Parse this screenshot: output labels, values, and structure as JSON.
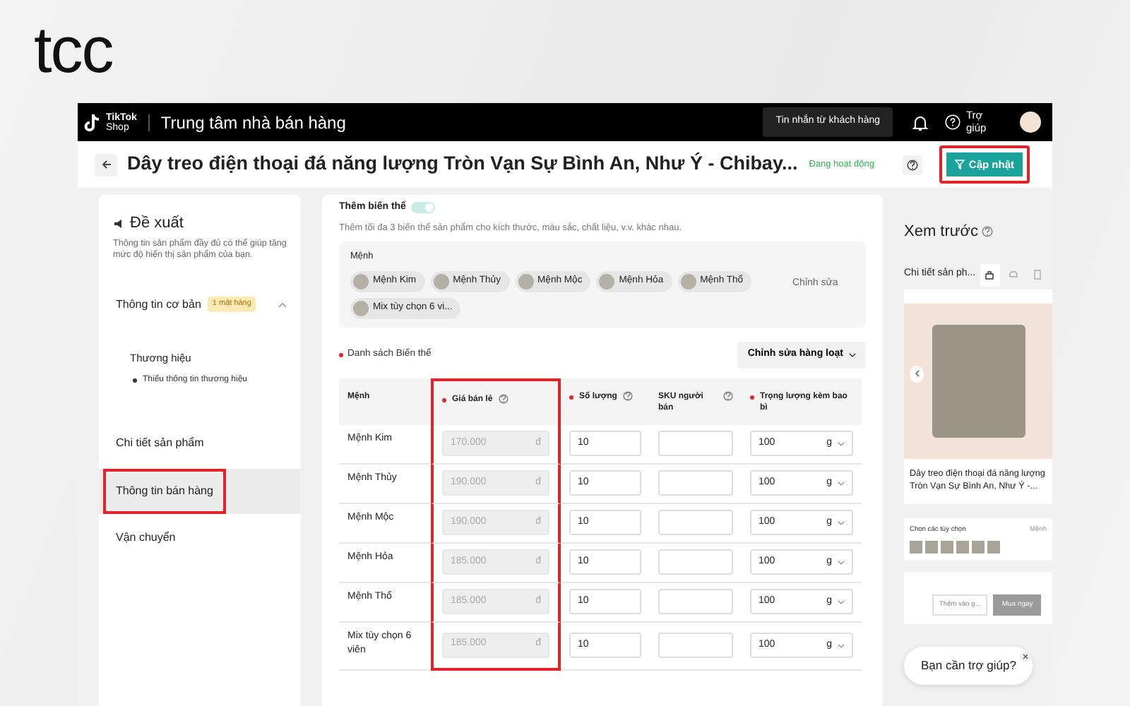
{
  "brand_logo": {
    "text": "tcc"
  },
  "header": {
    "shop_logo": {
      "line1": "TikTok",
      "line2": "Shop"
    },
    "title": "Trung tâm nhà bán hàng",
    "messages_button": "Tin nhắn từ khách hàng",
    "help": "Trợ giúp"
  },
  "product_bar": {
    "title": "Dây treo điện thoại đá năng lượng Tròn Vạn Sự Bình An, Như Ý - Chibay...",
    "status": "Đang hoạt động",
    "update_button": {
      "label": "Cập nhật",
      "highlighted": true
    }
  },
  "sidebar": {
    "heading": "Đề xuất",
    "description": "Thông tin sản phẩm đầy đủ có thể giúp tăng mức độ hiển thị sản phẩm của bạn.",
    "sections": [
      {
        "label": "Thông tin cơ bản",
        "badge": "1 mặt hàng",
        "expanded": true,
        "selected": false,
        "highlighted": false,
        "children": [
          {
            "label": "Thương hiệu",
            "note": "Thiếu thông tin thương hiệu"
          }
        ]
      },
      {
        "label": "Chi tiết sản phẩm",
        "selected": false,
        "highlighted": false
      },
      {
        "label": "Thông tin bán hàng",
        "selected": true,
        "highlighted": true
      },
      {
        "label": "Vận chuyển",
        "selected": false,
        "highlighted": false
      }
    ]
  },
  "variants": {
    "toggle": {
      "label": "Thêm biến thể",
      "on": true
    },
    "description": "Thêm tối đa 3 biến thể sản phẩm cho kích thước, màu sắc, chất liệu, v.v. khác nhau.",
    "group": {
      "name": "Mệnh",
      "options": [
        "Mệnh Kim",
        "Mệnh Thủy",
        "Mệnh Mộc",
        "Mệnh Hỏa",
        "Mệnh Thổ",
        "Mix tùy chọn 6 vi..."
      ],
      "edit": "Chỉnh sửa"
    },
    "list_label": "Danh sách Biến thể",
    "list_required": true,
    "bulk_edit": "Chỉnh sửa hàng loạt",
    "table": {
      "columns": [
        {
          "label": "Mệnh",
          "required": false,
          "help": false,
          "highlighted": false
        },
        {
          "label": "Giá bán lẻ",
          "required": true,
          "help": true,
          "highlighted": true
        },
        {
          "label": "Số lượng",
          "required": true,
          "help": true,
          "highlighted": false
        },
        {
          "label": "SKU người bán",
          "required": false,
          "help": true,
          "highlighted": false
        },
        {
          "label": "Trọng lượng kèm bao bì",
          "required": true,
          "help": false,
          "highlighted": false
        }
      ],
      "rows": [
        {
          "name": "Mệnh Kim",
          "price": "170.000",
          "currency": "đ",
          "quantity": "10",
          "weight": "100",
          "unit": "g"
        },
        {
          "name": "Mệnh Thủy",
          "price": "190.000",
          "currency": "đ",
          "quantity": "10",
          "weight": "100",
          "unit": "g"
        },
        {
          "name": "Mệnh Mộc",
          "price": "190.000",
          "currency": "đ",
          "quantity": "10",
          "weight": "100",
          "unit": "g"
        },
        {
          "name": "Mệnh Hỏa",
          "price": "185.000",
          "currency": "đ",
          "quantity": "10",
          "weight": "100",
          "unit": "g"
        },
        {
          "name": "Mệnh Thổ",
          "price": "185.000",
          "currency": "đ",
          "quantity": "10",
          "weight": "100",
          "unit": "g"
        },
        {
          "name": "Mix tùy chọn 6 viên",
          "price": "185.000",
          "currency": "đ",
          "quantity": "10",
          "weight": "100",
          "unit": "g"
        }
      ]
    }
  },
  "preview": {
    "heading": "Xem trước",
    "tab_label": "Chi tiết sản ph...",
    "product_title": "Dây treo điện thoại đá năng lượng Tròn Vạn Sự Bình An, Như Ý -...",
    "options_label": "Chọn các tùy chọn",
    "options_group": "Mệnh",
    "cart_button": "Thêm vào g...",
    "buy_button": "Mua ngay"
  },
  "help_bubble": {
    "text": "Bạn cần trợ giúp?"
  }
}
